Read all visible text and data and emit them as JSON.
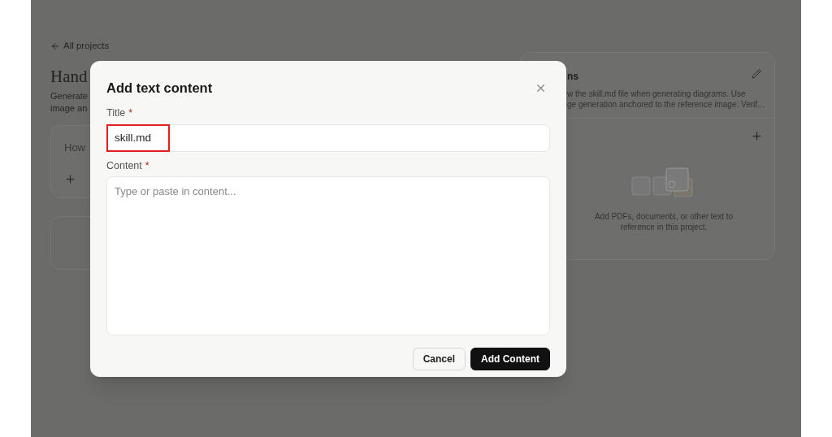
{
  "page": {
    "back_link": "All projects",
    "project_title": "Hand",
    "description_lines": [
      "Generate",
      "image an"
    ],
    "prompt_card": {
      "text": "How"
    },
    "instructions_card": {
      "heading": "ns",
      "lines": [
        "w the skill.md file when generating diagrams. Use",
        "ge generation anchored to the reference image. Verif…"
      ]
    },
    "files_card": {
      "empty_text": "Add PDFs, documents, or other text to reference in this project."
    }
  },
  "dialog": {
    "title": "Add text content",
    "fields": [
      {
        "label": "Title",
        "required": "*",
        "value": "skill.md",
        "highlighted": true,
        "kind": "input"
      },
      {
        "label": "Content",
        "required": "*",
        "placeholder": "Type or paste in content...",
        "kind": "textarea"
      }
    ],
    "buttons": [
      {
        "label": "Cancel",
        "kind": "secondary"
      },
      {
        "label": "Add Content",
        "kind": "primary"
      }
    ]
  }
}
